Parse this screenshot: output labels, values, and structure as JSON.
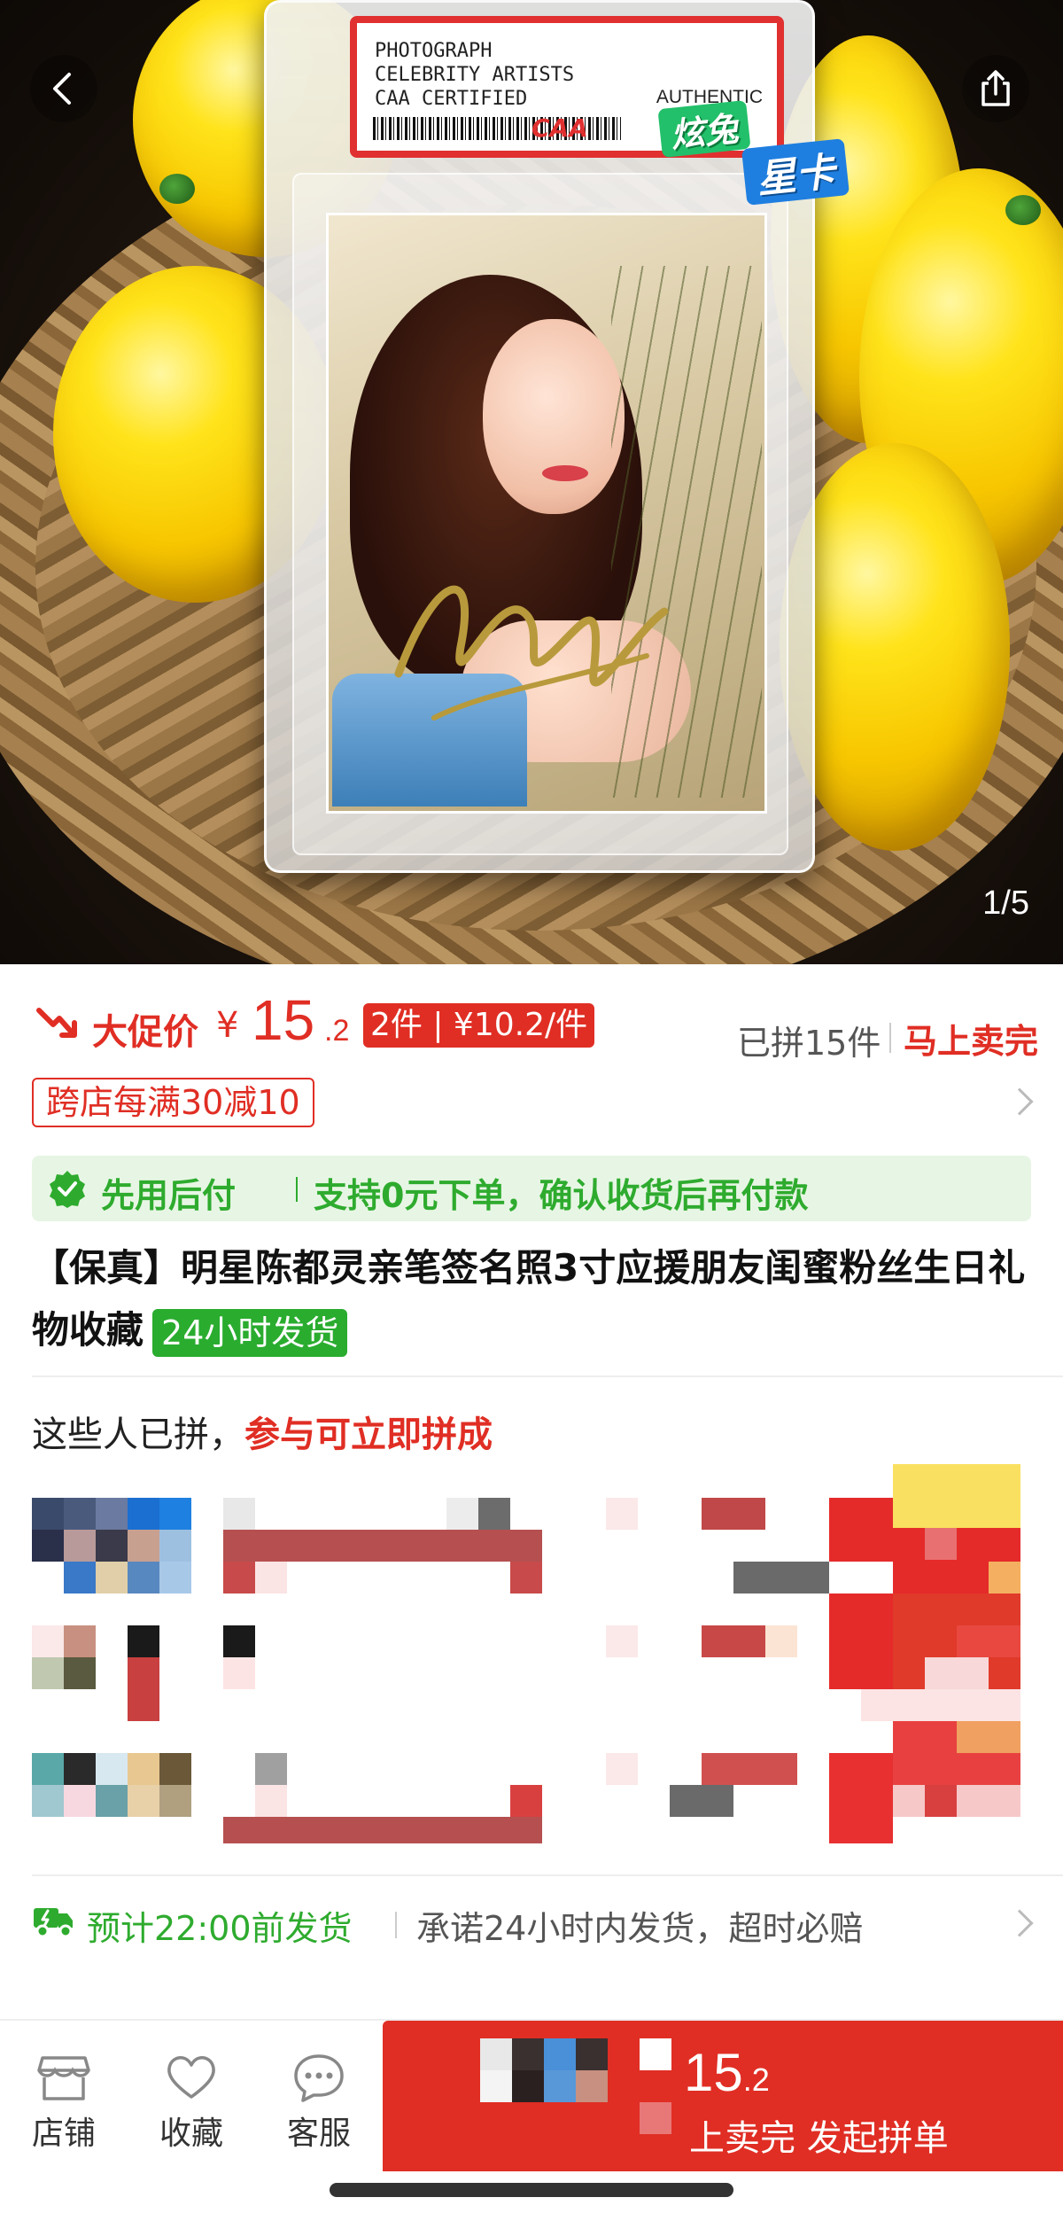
{
  "gallery": {
    "counter": "1/5",
    "card_label_lines": [
      "PHOTOGRAPH",
      "CELEBRITY ARTISTS",
      "CAA CERTIFIED"
    ],
    "card_label_right": "AUTHENTIC",
    "card_logo": "CAA",
    "brand_line1": "炫兔",
    "brand_line2": "星卡",
    "back_icon": "back-arrow-icon",
    "share_icon": "share-icon"
  },
  "price": {
    "promo_label": "大促价",
    "currency": "¥",
    "integer": "15",
    "decimal": ".2",
    "multi_buy": "2件 | ¥10.2/件",
    "sold": "已拼15件",
    "sellout": "马上卖完",
    "accent": "#e02e24"
  },
  "coupon": {
    "text": "跨店每满30减10"
  },
  "bnpl": {
    "title": "先用后付",
    "desc": "支持0元下单，确认收货后再付款",
    "color": "#2eab2e"
  },
  "product": {
    "title": "【保真】明星陈都灵亲笔签名照3寸应援朋友闺蜜粉丝生日礼物收藏",
    "ship_tag": "24小时发货"
  },
  "group": {
    "title_prefix": "这些人已拼，",
    "title_highlight": "参与可立即拼成"
  },
  "dispatch": {
    "eta": "预计22:00前发货",
    "promise": "承诺24小时内发货，超时必赔"
  },
  "bottom": {
    "tabs": [
      {
        "label": "店铺",
        "icon": "store-icon"
      },
      {
        "label": "收藏",
        "icon": "heart-icon"
      },
      {
        "label": "客服",
        "icon": "chat-icon"
      }
    ],
    "buy_price_int": "15",
    "buy_price_dec": ".2",
    "buy_label": "上卖完 发起拼单"
  }
}
